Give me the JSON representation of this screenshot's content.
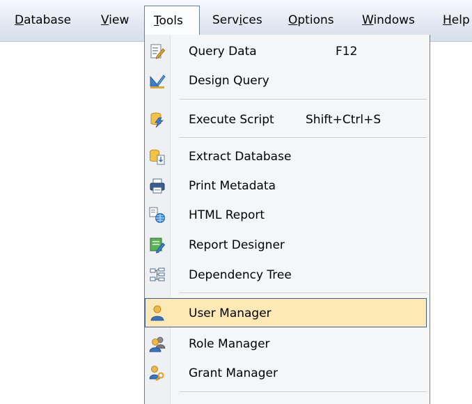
{
  "menubar": {
    "items": [
      {
        "label": "Database"
      },
      {
        "label": "View"
      },
      {
        "label": "Tools"
      },
      {
        "label": "Services"
      },
      {
        "label": "Options"
      },
      {
        "label": "Windows"
      },
      {
        "label": "Help"
      }
    ]
  },
  "tools_menu": {
    "items": [
      {
        "label": "Query Data",
        "shortcut": "F12",
        "icon": "query-data-icon"
      },
      {
        "label": "Design Query",
        "icon": "design-query-icon"
      },
      {
        "label": "Execute Script",
        "shortcut": "Shift+Ctrl+S",
        "icon": "execute-script-icon"
      },
      {
        "label": "Extract Database",
        "icon": "extract-database-icon"
      },
      {
        "label": "Print Metadata",
        "icon": "printer-icon"
      },
      {
        "label": "HTML Report",
        "icon": "html-report-icon"
      },
      {
        "label": "Report Designer",
        "icon": "report-designer-icon"
      },
      {
        "label": "Dependency Tree",
        "icon": "dependency-tree-icon"
      },
      {
        "label": "User Manager",
        "icon": "user-icon",
        "highlighted": true
      },
      {
        "label": "Role Manager",
        "icon": "role-users-icon"
      },
      {
        "label": "Grant Manager",
        "icon": "grant-key-icon"
      }
    ]
  },
  "colors": {
    "menubar_bg": "#dde5f0",
    "menu_bg": "#f5f6f7",
    "highlight_bg": "#fde9b6",
    "highlight_border": "#3e5f8a"
  }
}
